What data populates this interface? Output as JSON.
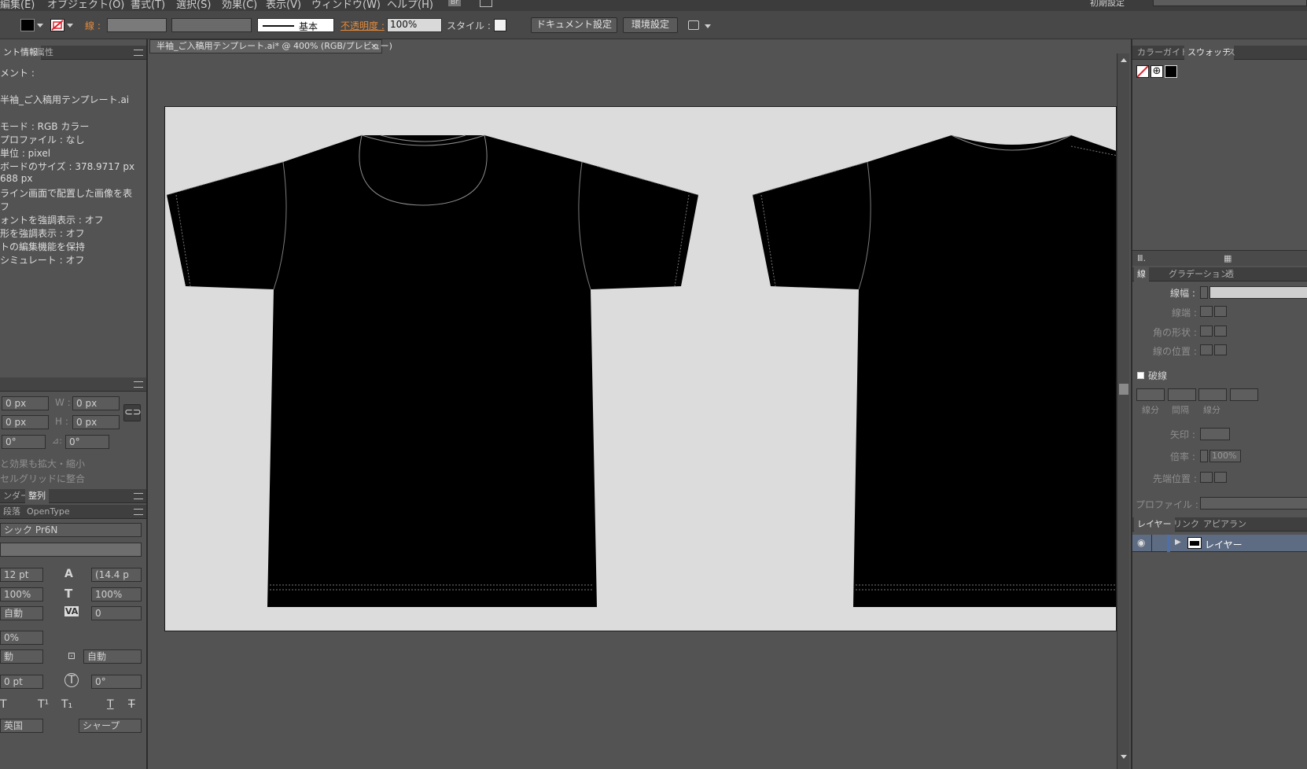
{
  "menu": [
    "編集(E)",
    "オブジェクト(O)",
    "書式(T)",
    "選択(S)",
    "効果(C)",
    "表示(V)",
    "ウィンドウ(W)",
    "ヘルプ(H)"
  ],
  "menu_right": {
    "workspace": "初期設定",
    "br_badge": "Br"
  },
  "control_bar": {
    "stroke_label": "線 :",
    "stroke_profile": "基本",
    "opacity_label": "不透明度 :",
    "opacity_value": "100%",
    "style_label": "スタイル :",
    "doc_setup_button": "ドキュメント設定",
    "prefs_button": "環境設定"
  },
  "left_panel": {
    "doc_info_tabs": [
      "ント情報",
      "属性"
    ],
    "info_lines": [
      "メント :",
      "半袖_ご入稿用テンプレート.ai",
      "モード : RGB カラー",
      "プロファイル : なし",
      "単位 : pixel",
      "ボードのサイズ : 378.9717 px",
      "688 px",
      "ライン画面で配置した画像を表",
      "フ",
      "ォントを強調表示 : オフ",
      "形を強調表示 : オフ",
      "トの編集機能を保持",
      "シミュレート : オフ"
    ],
    "transform": {
      "x_value": "0 px",
      "w_label": "W :",
      "w_value": "0 px",
      "y_value": "0 px",
      "h_label": "H :",
      "h_value": "0 px",
      "rotate_value": "0°",
      "shear_value": "0°",
      "scale_effects": "と効果も拡大・縮小",
      "pixel_grid": "セルグリッドに整合"
    },
    "align_tabs": [
      "ンダー",
      "整列"
    ],
    "char_tabs": [
      "段落",
      "OpenType"
    ],
    "font_family": "シック Pr6N",
    "font_size": "12 pt",
    "leading": "(14.4 p",
    "hscale": "100%",
    "vscale": "100%",
    "kerning": "自動",
    "tracking": "0",
    "tsume": "0%",
    "aki_left": "動",
    "aki_right": "自動",
    "baseline": "0 pt",
    "char_rotate": "0°",
    "antialias": "シャープ",
    "lang": "英国",
    "tt_labels": [
      "T",
      "T¹",
      "T₁",
      "T",
      "T"
    ]
  },
  "document_tab": {
    "title": "半袖_ご入稿用テンプレート.ai* @ 400% (RGB/プレビュー)",
    "close": "×"
  },
  "right_panel": {
    "top_tabs": [
      "カラーガイド",
      "スウォッチ",
      "ス"
    ],
    "stroke_tabs": [
      "線",
      "グラデーション",
      "透"
    ],
    "stroke_width_label": "線幅 :",
    "cap_label": "線端 :",
    "corner_label": "角の形状 :",
    "align_label": "線の位置 :",
    "dashed_label": "破線",
    "dash_labels": [
      "線分",
      "間隔",
      "線分"
    ],
    "arrow_label": "矢印 :",
    "scale_label": "倍率 :",
    "scale_value": "100%",
    "tip_label": "先端位置 :",
    "profile_label": "プロファイル :",
    "layer_tabs": [
      "レイヤー",
      "リンク",
      "アピアラン"
    ],
    "layer_name": "レイヤー"
  },
  "colors": {
    "accent_orange": "#e38a3a",
    "artboard": "#dcdcdc",
    "shirt": "#000000",
    "layer_highlight": "#4f6fa8"
  }
}
